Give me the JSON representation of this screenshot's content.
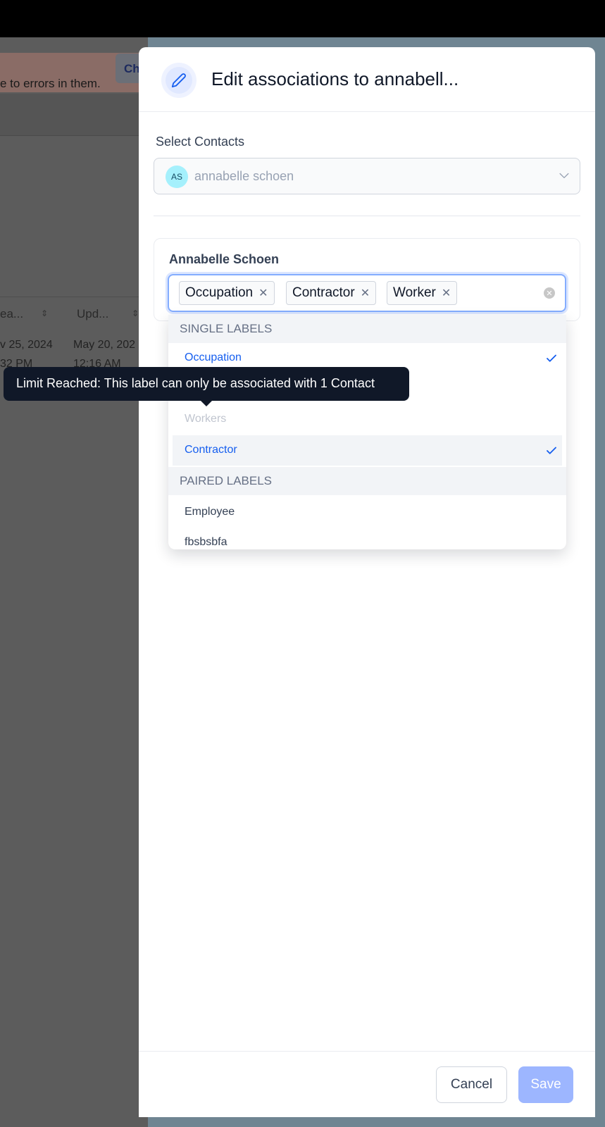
{
  "background": {
    "alert_text": "e to errors in them.",
    "alert_button": "Ch",
    "columns": [
      "ea...",
      "Upd..."
    ],
    "row": {
      "created_date": "v 25, 2024",
      "created_time": "32 PM",
      "updated_date": "May 20, 202",
      "updated_time": "12:16 AM"
    }
  },
  "drawer": {
    "title": "Edit associations to annabell...",
    "select_label": "Select Contacts",
    "contact": {
      "initials": "AS",
      "name": "annabelle schoen"
    },
    "card": {
      "title": "Annabelle Schoen",
      "tags": [
        "Occupation",
        "Contractor",
        "Worker"
      ]
    },
    "dropdown": {
      "single_header": "SINGLE LABELS",
      "single_options": [
        {
          "label": "Occupation",
          "state": "selected"
        },
        {
          "label": "Workers",
          "state": "disabled"
        },
        {
          "label": "Contractor",
          "state": "selected"
        }
      ],
      "paired_header": "PAIRED LABELS",
      "paired_options": [
        "Employee",
        "fbsbsbfa"
      ]
    },
    "tooltip": "Limit Reached: This label can only be associated with 1 Contact",
    "cancel_label": "Cancel",
    "save_label": "Save"
  },
  "colors": {
    "accent": "#155eef",
    "save_disabled": "#9db6ff",
    "tooltip": "#101828"
  }
}
